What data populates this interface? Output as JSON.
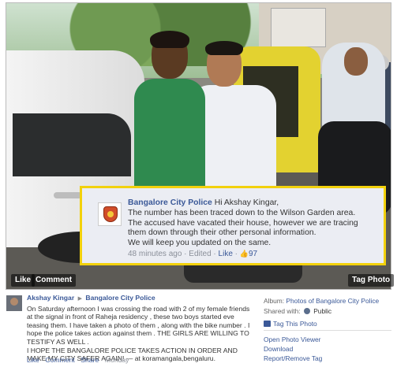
{
  "photo_actions": {
    "like": "Like",
    "comment": "Comment",
    "tag_photo": "Tag Photo"
  },
  "police_reply": {
    "name": "Bangalore City Police",
    "greeting": "Hi Akshay Kingar,",
    "lines": [
      "The number has been traced down to the Wilson Garden area.",
      "The accused have vacated their house, however we are tracing",
      "them down through their other personal information.",
      "We will keep you updated on the same."
    ],
    "time": "48 minutes ago",
    "edited": "Edited",
    "like": "Like",
    "likes_count": "97",
    "avatar_icon": "police-emblem-icon"
  },
  "post": {
    "author": "Akshay Kingar",
    "target": "Bangalore City Police",
    "body": "On Saturday afternoon I was crossing the road with 2 of my female friends at the signal in front of Raheja residency , these two boys started eve teasing them. I have taken a photo of them , along with the bike number . I hope the police takes action against them . THE GIRLS ARE WILLING TO TESTIFY AS WELL .",
    "body2": "I HOPE THE BANGALORE POLICE TAKES ACTION IN ORDER AND MAKE MY CITY SAFER AGAIN! — at koramangala,bengaluru.",
    "actions": [
      "Like",
      "Comment",
      "Share"
    ],
    "date": "Monday"
  },
  "sidebar": {
    "album_label": "Album:",
    "album_name": "Photos of Bangalore City Police",
    "shared_label": "Shared with:",
    "shared_value": "Public",
    "tag_this_photo": "Tag This Photo",
    "open_viewer": "Open Photo Viewer",
    "download": "Download",
    "report": "Report/Remove Tag"
  },
  "colors": {
    "link": "#3b5998",
    "highlight_border": "#f2d10c",
    "reply_bg": "#ebedf3"
  }
}
